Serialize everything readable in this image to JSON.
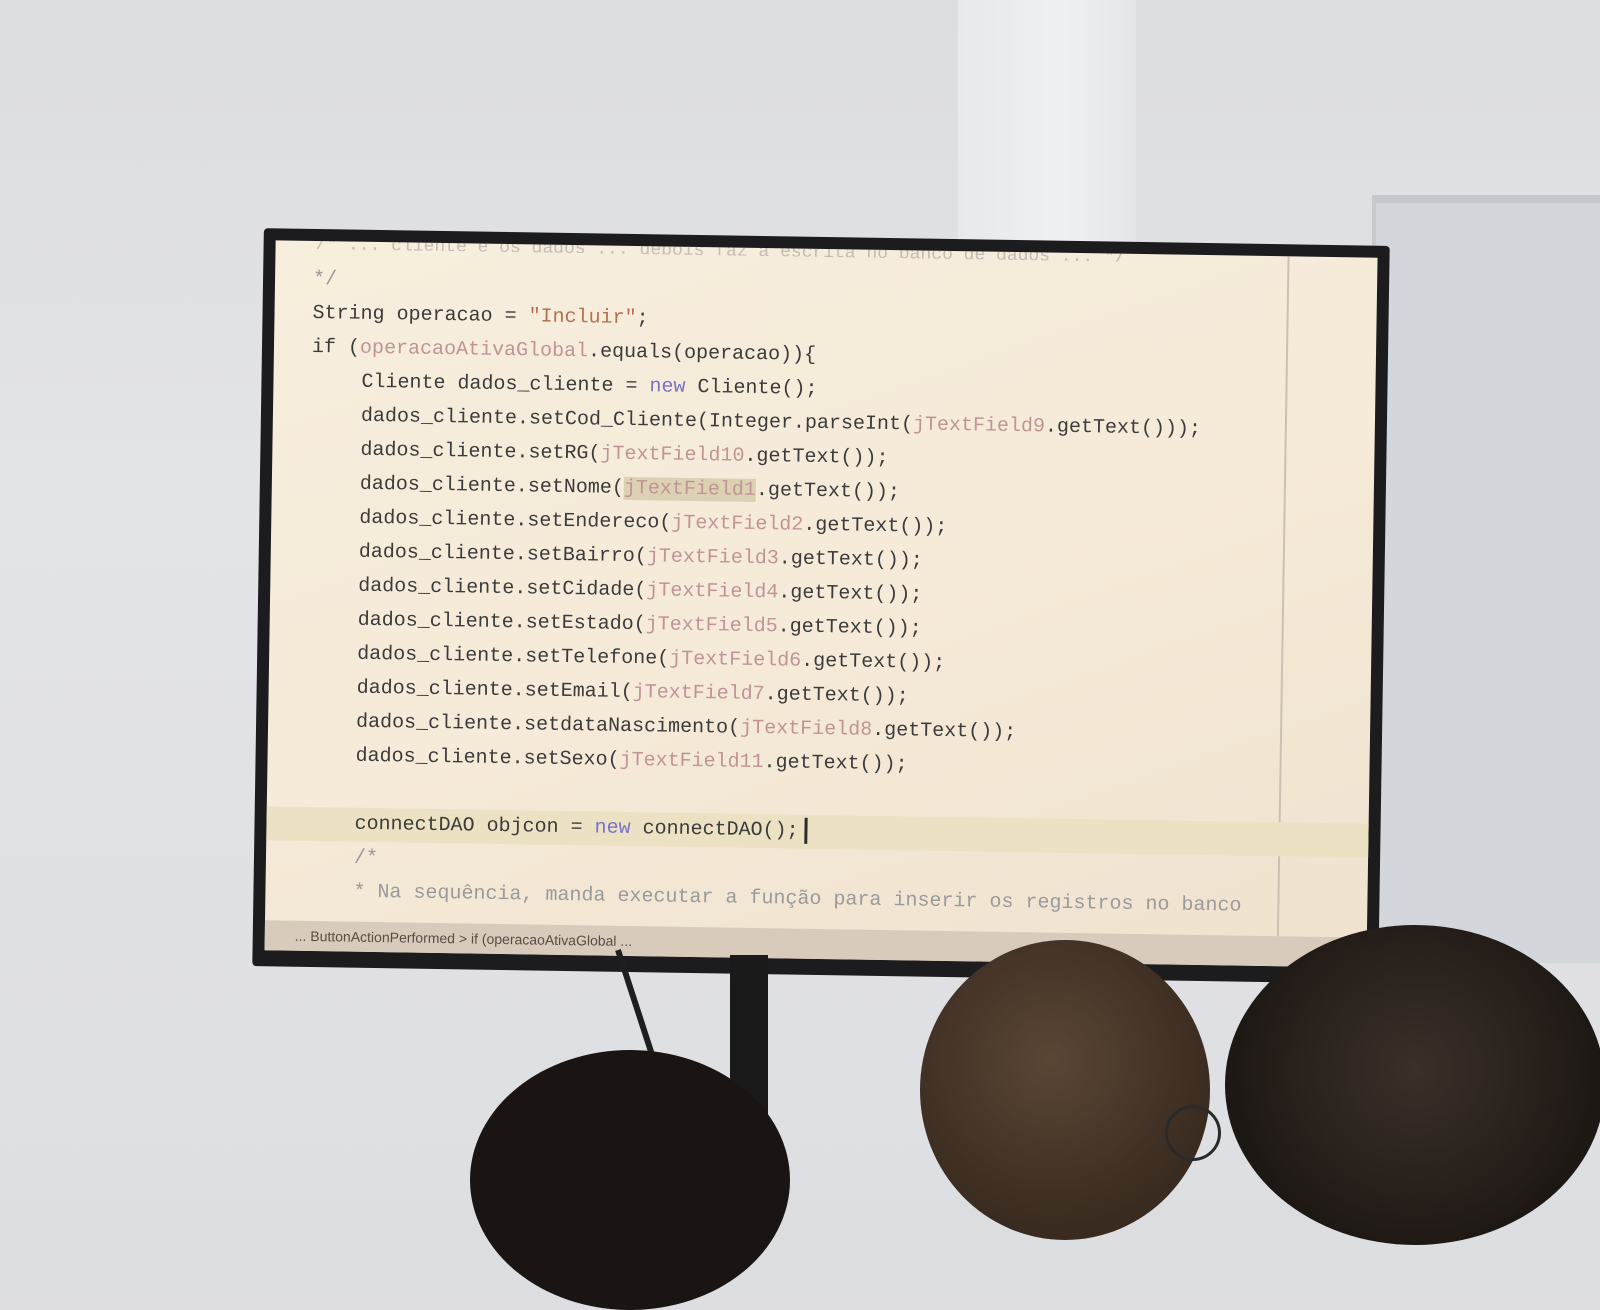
{
  "editor": {
    "top_partial_line": "/* ... cliente e os dados ... depois faz a escrita no banco de dados ... */",
    "lines": [
      {
        "parts": [
          {
            "t": "*/",
            "c": "cmt"
          }
        ]
      },
      {
        "parts": [
          {
            "t": "String operacao = "
          },
          {
            "t": "\"Incluir\"",
            "c": "str"
          },
          {
            "t": ";"
          }
        ]
      },
      {
        "parts": [
          {
            "t": "if ("
          },
          {
            "t": "operacaoAtivaGlobal",
            "c": "fld"
          },
          {
            "t": ".equals(operacao)){"
          }
        ]
      },
      {
        "indent": 1,
        "parts": [
          {
            "t": "Cliente dados_cliente = "
          },
          {
            "t": "new",
            "c": "kw"
          },
          {
            "t": " Cliente();"
          }
        ]
      },
      {
        "indent": 1,
        "parts": [
          {
            "t": "dados_cliente.setCod_Cliente(Integer.parseInt("
          },
          {
            "t": "jTextField9",
            "c": "fld"
          },
          {
            "t": ".getText()));"
          }
        ]
      },
      {
        "indent": 1,
        "parts": [
          {
            "t": "dados_cliente.setRG("
          },
          {
            "t": "jTextField10",
            "c": "fld"
          },
          {
            "t": ".getText());"
          }
        ]
      },
      {
        "indent": 1,
        "parts": [
          {
            "t": "dados_cliente.setNome("
          },
          {
            "t": "jTextField1",
            "c": "fld hl-word"
          },
          {
            "t": ".getText());"
          }
        ]
      },
      {
        "indent": 1,
        "parts": [
          {
            "t": "dados_cliente.setEndereco("
          },
          {
            "t": "jTextField2",
            "c": "fld"
          },
          {
            "t": ".getText());"
          }
        ]
      },
      {
        "indent": 1,
        "parts": [
          {
            "t": "dados_cliente.setBairro("
          },
          {
            "t": "jTextField3",
            "c": "fld"
          },
          {
            "t": ".getText());"
          }
        ]
      },
      {
        "indent": 1,
        "parts": [
          {
            "t": "dados_cliente.setCidade("
          },
          {
            "t": "jTextField4",
            "c": "fld"
          },
          {
            "t": ".getText());"
          }
        ]
      },
      {
        "indent": 1,
        "parts": [
          {
            "t": "dados_cliente.setEstado("
          },
          {
            "t": "jTextField5",
            "c": "fld"
          },
          {
            "t": ".getText());"
          }
        ]
      },
      {
        "indent": 1,
        "parts": [
          {
            "t": "dados_cliente.setTelefone("
          },
          {
            "t": "jTextField6",
            "c": "fld"
          },
          {
            "t": ".getText());"
          }
        ]
      },
      {
        "indent": 1,
        "parts": [
          {
            "t": "dados_cliente.setEmail("
          },
          {
            "t": "jTextField7",
            "c": "fld"
          },
          {
            "t": ".getText());"
          }
        ]
      },
      {
        "indent": 1,
        "parts": [
          {
            "t": "dados_cliente.setdataNascimento("
          },
          {
            "t": "jTextField8",
            "c": "fld"
          },
          {
            "t": ".getText());"
          }
        ]
      },
      {
        "indent": 1,
        "parts": [
          {
            "t": "dados_cliente.setSexo("
          },
          {
            "t": "jTextField11",
            "c": "fld"
          },
          {
            "t": ".getText());"
          }
        ]
      },
      {
        "indent": 1,
        "parts": [
          {
            "t": ""
          }
        ]
      },
      {
        "indent": 1,
        "current": true,
        "parts": [
          {
            "t": "connectDAO objcon = "
          },
          {
            "t": "new",
            "c": "kw"
          },
          {
            "t": " connectDAO();"
          }
        ]
      },
      {
        "indent": 1,
        "parts": [
          {
            "t": "/*",
            "c": "cmt"
          }
        ]
      },
      {
        "indent": 1,
        "parts": [
          {
            "t": "* Na sequência, manda executar a função para inserir os registros no banco",
            "c": "cmt"
          }
        ]
      }
    ],
    "status_bar": "... ButtonActionPerformed  >  if (operacaoAtivaGlobal ..."
  }
}
